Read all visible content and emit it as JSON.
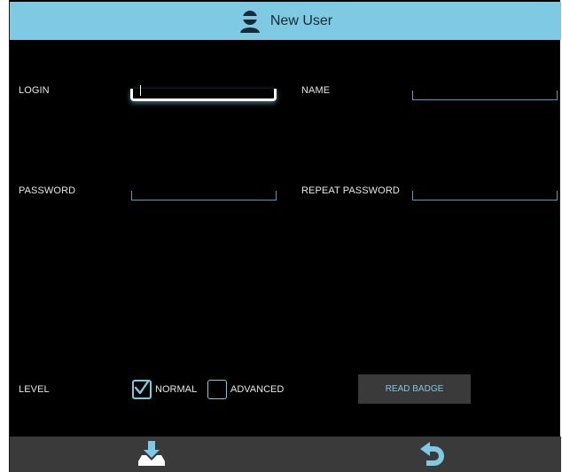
{
  "header": {
    "title": "New User",
    "icon": "user-icon"
  },
  "form": {
    "login_label": "LOGIN",
    "login_value": "",
    "name_label": "NAME",
    "name_value": "",
    "password_label": "PASSWORD",
    "password_value": "",
    "repeat_password_label": "REPEAT PASSWORD",
    "repeat_password_value": "",
    "level_label": "LEVEL",
    "level_options": [
      {
        "label": "NORMAL",
        "checked": true
      },
      {
        "label": "ADVANCED",
        "checked": false
      }
    ],
    "read_badge_label": "READ BADGE"
  },
  "footer": {
    "save_icon": "download-tray-icon",
    "back_icon": "undo-arrow-icon"
  },
  "colors": {
    "accent": "#7ec9e3",
    "background": "#000000",
    "footer": "#3a3a3a",
    "field_line": "#4fa0bf"
  }
}
